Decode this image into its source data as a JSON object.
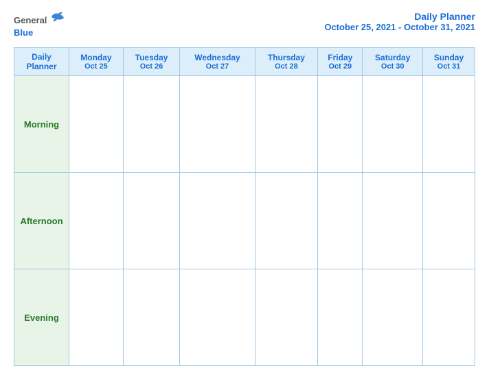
{
  "header": {
    "logo": {
      "general": "General",
      "blue": "Blue"
    },
    "title": "Daily Planner",
    "date_range": "October 25, 2021 - October 31, 2021"
  },
  "table": {
    "columns": [
      {
        "id": "label",
        "day": "Daily",
        "day2": "Planner",
        "date": ""
      },
      {
        "id": "mon",
        "day": "Monday",
        "date": "Oct 25"
      },
      {
        "id": "tue",
        "day": "Tuesday",
        "date": "Oct 26"
      },
      {
        "id": "wed",
        "day": "Wednesday",
        "date": "Oct 27"
      },
      {
        "id": "thu",
        "day": "Thursday",
        "date": "Oct 28"
      },
      {
        "id": "fri",
        "day": "Friday",
        "date": "Oct 29"
      },
      {
        "id": "sat",
        "day": "Saturday",
        "date": "Oct 30"
      },
      {
        "id": "sun",
        "day": "Sunday",
        "date": "Oct 31"
      }
    ],
    "rows": [
      {
        "id": "morning",
        "label": "Morning"
      },
      {
        "id": "afternoon",
        "label": "Afternoon"
      },
      {
        "id": "evening",
        "label": "Evening"
      }
    ]
  }
}
